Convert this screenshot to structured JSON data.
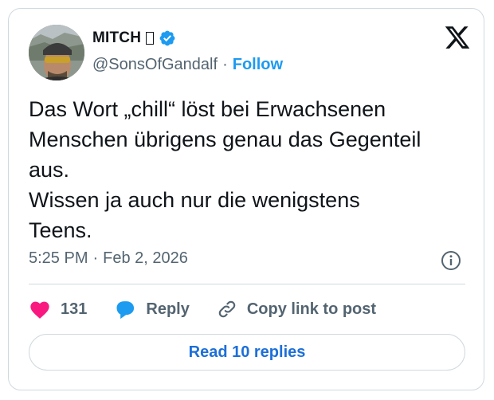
{
  "author": {
    "display_name": "MITCH",
    "emoji_placeholder": "▯",
    "handle": "@SonsOfGandalf",
    "separator": "·",
    "follow_label": "Follow"
  },
  "tweet": {
    "lines": [
      "Das Wort „chill“ löst bei Erwachsenen",
      "Menschen übrigens genau das Gegenteil",
      "aus.",
      "Wissen ja auch nur die wenigstens",
      "Teens."
    ],
    "time": "5:25 PM",
    "separator": "·",
    "date": "Feb 2, 2026"
  },
  "actions": {
    "like_count": "131",
    "reply_label": "Reply",
    "copy_label": "Copy link to post"
  },
  "read_replies_label": "Read 10 replies",
  "colors": {
    "accent": "#1d9bf0",
    "heart": "#f91880",
    "border": "#cfd9de",
    "muted": "#536471"
  }
}
